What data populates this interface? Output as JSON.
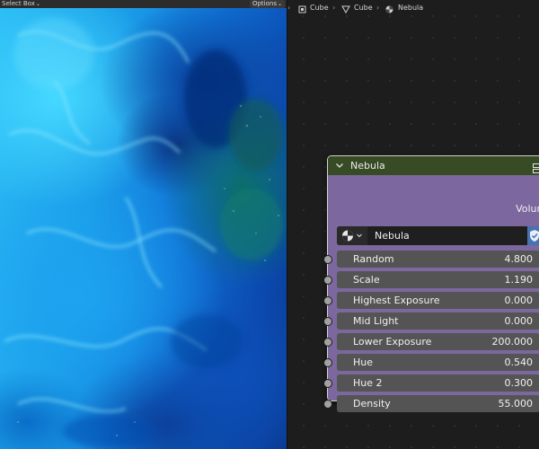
{
  "viewport": {
    "select_mode_label": "Select Box",
    "options_label": "Options"
  },
  "breadcrumb": {
    "items": [
      "Cube",
      "Cube",
      "Nebula"
    ]
  },
  "node": {
    "title": "Nebula",
    "output_label": "Volume",
    "group_name": "Nebula",
    "header_color": "#374b24",
    "body_color": "#7c679e",
    "inputs": [
      {
        "label": "Random",
        "value": "4.800"
      },
      {
        "label": "Scale",
        "value": "1.190"
      },
      {
        "label": "Highest Exposure",
        "value": "0.000"
      },
      {
        "label": "Mid Light",
        "value": "0.000"
      },
      {
        "label": "Lower Exposure",
        "value": "200.000"
      },
      {
        "label": "Hue",
        "value": "0.540"
      },
      {
        "label": "Hue 2",
        "value": "0.300"
      },
      {
        "label": "Density",
        "value": "55.000"
      }
    ]
  },
  "icons": {
    "object": "object-icon",
    "mesh": "mesh-icon",
    "material": "material-icon",
    "node_group": "node-group-icon",
    "fake_user": "shield-check-icon"
  }
}
